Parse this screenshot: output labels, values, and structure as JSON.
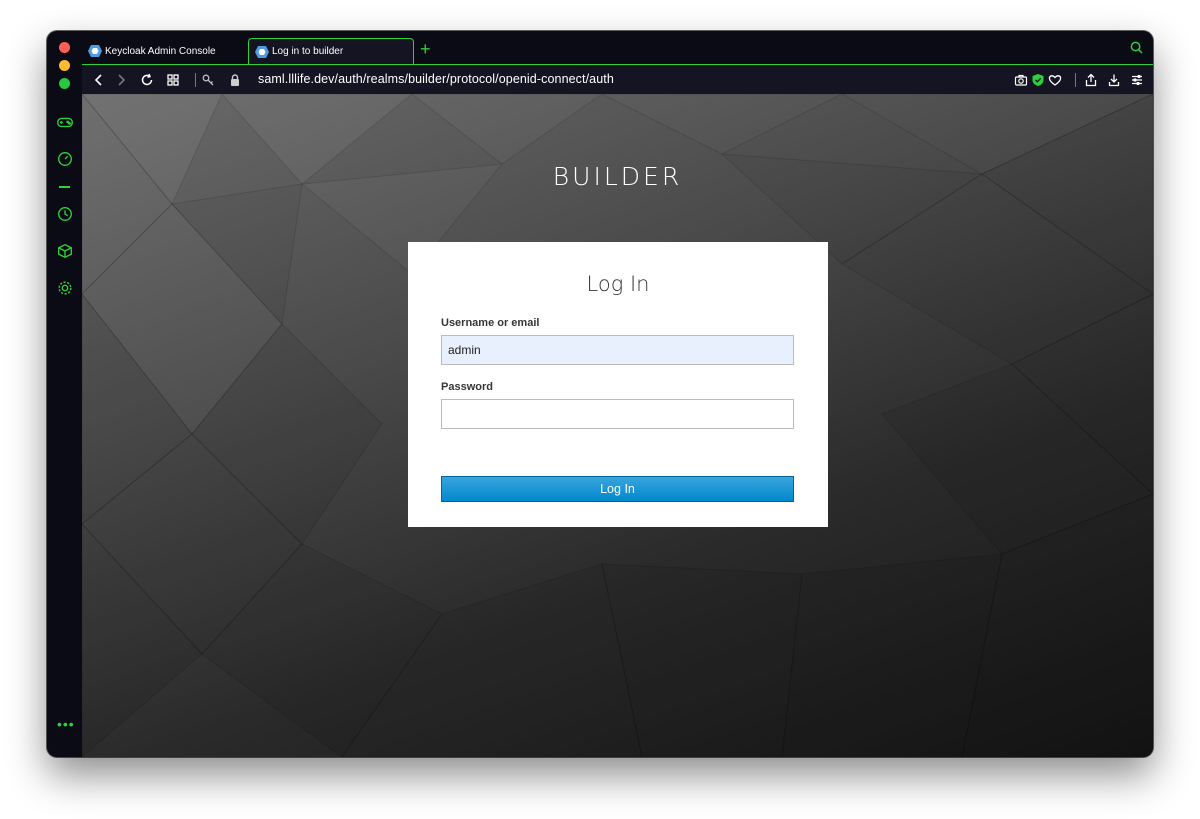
{
  "browser": {
    "tabs": [
      {
        "label": "Keycloak Admin Console",
        "active": false
      },
      {
        "label": "Log in to builder",
        "active": true
      }
    ],
    "new_tab_symbol": "+",
    "url": "saml.lllife.dev/auth/realms/builder/protocol/openid-connect/auth",
    "accent_color": "#2fd13a",
    "sidebar_icons": [
      "gamepad-icon",
      "speedometer-icon",
      "history-icon",
      "cube-icon",
      "settings-icon"
    ],
    "toolbar_icons": [
      "back-icon",
      "forward-icon",
      "reload-icon",
      "tiles-icon",
      "key-icon",
      "lock-icon",
      "camera-icon",
      "shield-icon",
      "heart-icon",
      "share-icon",
      "download-icon",
      "menu-icon"
    ]
  },
  "page": {
    "realm_title": "BUILDER",
    "form": {
      "title": "Log In",
      "username_label": "Username or email",
      "username_value": "admin",
      "password_label": "Password",
      "password_value": "",
      "submit_label": "Log In"
    },
    "button_color": "#0088ce"
  }
}
